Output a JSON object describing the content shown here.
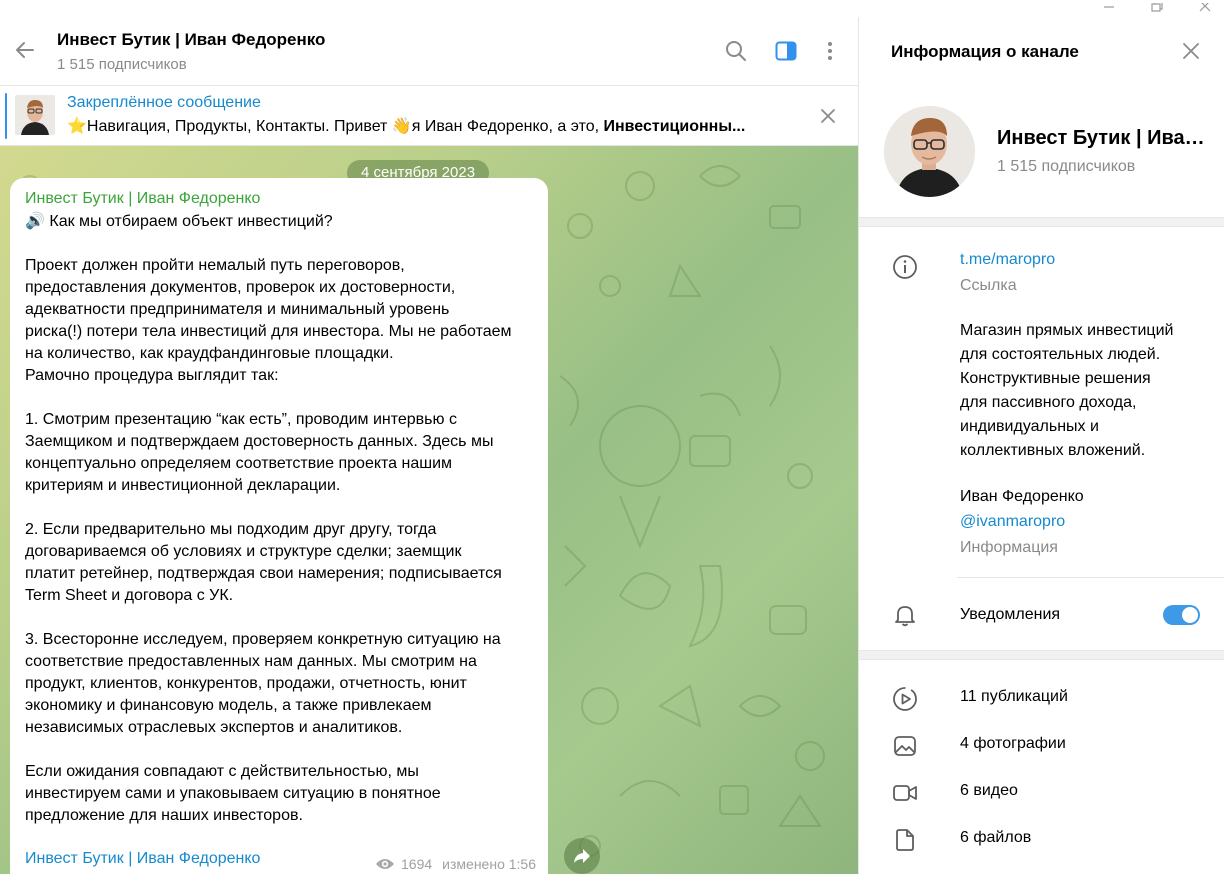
{
  "chat": {
    "title": "Инвест Бутик | Иван Федоренко",
    "subscribers": "1 515 подписчиков",
    "pinned": {
      "label": "Закреплённое сообщение",
      "text_plain": "⭐Навигация, Продукты, Контакты.  Привет 👋я Иван Федоренко, а это, ",
      "text_bold": "Инвестиционны..."
    },
    "date_chip": "4 сентября 2023",
    "message": {
      "author": "Инвест Бутик | Иван Федоренко",
      "lines": [
        "🔊 Как мы отбираем объект инвестиций?",
        "",
        "Проект должен пройти немалый путь переговоров,",
        "предоставления документов, проверок их достоверности,",
        "адекватности предпринимателя и минимальный уровень",
        "риска(!) потери тела инвестиций для инвестора. Мы не работаем",
        "на количество, как краудфандинговые площадки.",
        "Рамочно процедура выглядит так:",
        "",
        "1. Смотрим презентацию “как есть”, проводим интервью с",
        "Заемщиком и подтверждаем достоверность данных. Здесь мы",
        "концептуально определяем соответствие проекта нашим",
        "критериям и инвестиционной декларации.",
        "",
        "2. Если предварительно мы подходим друг другу, тогда",
        "договариваемся об условиях и структуре сделки; заемщик",
        "платит ретейнер, подтверждая свои намерения; подписывается",
        "Term Sheet и договора с УК.",
        "",
        "3. Всесторонне исследуем, проверяем конкретную ситуацию на",
        "соответствие предоставленных нам данных. Мы смотрим на",
        "продукт, клиентов, конкурентов, продажи, отчетность, юнит",
        "экономику и финансовую модель, а также привлекаем",
        "независимых отраслевых экспертов и аналитиков.",
        "",
        "Если ожидания совпадают с действительностью, мы",
        "инвестируем сами и упаковываем ситуацию в понятное",
        "предложение для наших инвесторов."
      ],
      "signature": "Инвест Бутик | Иван Федоренко",
      "views": "1694",
      "edited": "изменено 1:56"
    }
  },
  "info": {
    "title": "Информация о канале",
    "channel_name": "Инвест Бутик | Иван Федоренко",
    "channel_sub": "1 515 подписчиков",
    "link": "t.me/maropro",
    "link_caption": "Ссылка",
    "description_lines": [
      "Магазин прямых инвестиций",
      "для состоятельных людей.",
      "Конструктивные решения",
      "для пассивного дохода,",
      "индивидуальных и",
      "коллективных вложений.",
      "",
      "Иван Федоренко"
    ],
    "username": "@ivanmaropro",
    "info_caption": "Информация",
    "notifications_label": "Уведомления",
    "notifications_on": true,
    "stats": {
      "posts": "11 публикаций",
      "photos": "4 фотографии",
      "videos": "6 видео",
      "files": "6 файлов"
    }
  },
  "colors": {
    "accent": "#168acd",
    "author_green": "#3ba53a",
    "toggle": "#3e9ae6"
  }
}
